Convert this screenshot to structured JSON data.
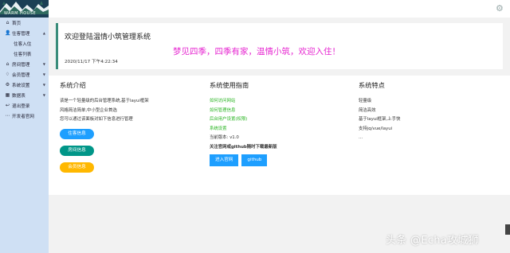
{
  "logo": {
    "text": "WARM HOUSE"
  },
  "sidebar": {
    "items": [
      {
        "label": "首页",
        "icon": "home-icon"
      },
      {
        "label": "住客管理",
        "icon": "user-icon",
        "expanded": true,
        "children": [
          {
            "label": "住客入住"
          },
          {
            "label": "住客列表"
          }
        ]
      },
      {
        "label": "房间管理",
        "icon": "home-icon"
      },
      {
        "label": "会员管理",
        "icon": "diamond-icon"
      },
      {
        "label": "系统设置",
        "icon": "gear-icon"
      },
      {
        "label": "数据表",
        "icon": "table-icon"
      },
      {
        "label": "退出登录",
        "icon": "logout-icon"
      },
      {
        "label": "开发者官网",
        "icon": "code-icon"
      }
    ]
  },
  "welcome": {
    "title": "欢迎登陆温情小筑管理系统",
    "poem": "梦见四季，四季有家，温情小筑，欢迎入住！",
    "time": "2020/11/17 下午4:22:34"
  },
  "intro": {
    "title": "系统介绍",
    "lines": [
      "该是一个轻量级的后台管理系统,基于layui框架",
      "风格简洁简单,中小型企业首选",
      "您可以通过该面板对如下信息进行管理"
    ],
    "buttons": [
      "住客信息",
      "房间信息",
      "会员信息"
    ]
  },
  "guide": {
    "title": "系统使用指南",
    "links": [
      "如何访问网站",
      "如何管理信息",
      "后台用户设置(权限)",
      "系统设置"
    ],
    "version": "当前版本: v1.0",
    "notice": "关注官网或github随时下载最新版",
    "buttons": [
      "进入官网",
      "github"
    ]
  },
  "features": {
    "title": "系统特点",
    "lines": [
      "轻量级",
      "简洁高效",
      "基于layui框架,上手快",
      "支持jq/vue/layui",
      "..."
    ]
  },
  "watermark": "头条 @Echa攻城狮",
  "colors": {
    "sidebar_bg": "#cfe0f4",
    "logo_bg": "#1b3f55",
    "welcome_border": "#3a8c7a",
    "poem": "#e626d0",
    "link_green": "#28b421",
    "btn_blue": "#1e9fff",
    "btn_green": "#009688",
    "btn_orange": "#ffb800"
  }
}
